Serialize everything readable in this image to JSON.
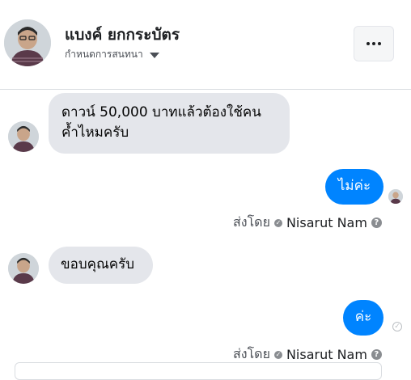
{
  "header": {
    "contact_name": "แบงค์ ยกกระบัตร",
    "subtitle": "กำหนดการสนทนา",
    "avatar_icon": "person-avatar-icon",
    "more_icon": "more-dots-icon"
  },
  "messages": [
    {
      "direction": "in",
      "lines": [
        "ดาวน์ 50,000 บาทแล้วต้องใช้คน",
        "ค้ำไหมครับ"
      ]
    },
    {
      "direction": "out",
      "text": "ไม่ค่ะ"
    },
    {
      "direction": "in",
      "text": "ขอบคุณครับ"
    },
    {
      "direction": "out",
      "text": "ค่ะ"
    }
  ],
  "sent_by": {
    "label": "ส่งโดย",
    "name": "Nisarut Nam",
    "help_glyph": "?"
  },
  "colors": {
    "accent": "#0084ff",
    "incoming_bubble": "#e4e6eb",
    "text": "#050505",
    "muted": "#4b4f56"
  }
}
